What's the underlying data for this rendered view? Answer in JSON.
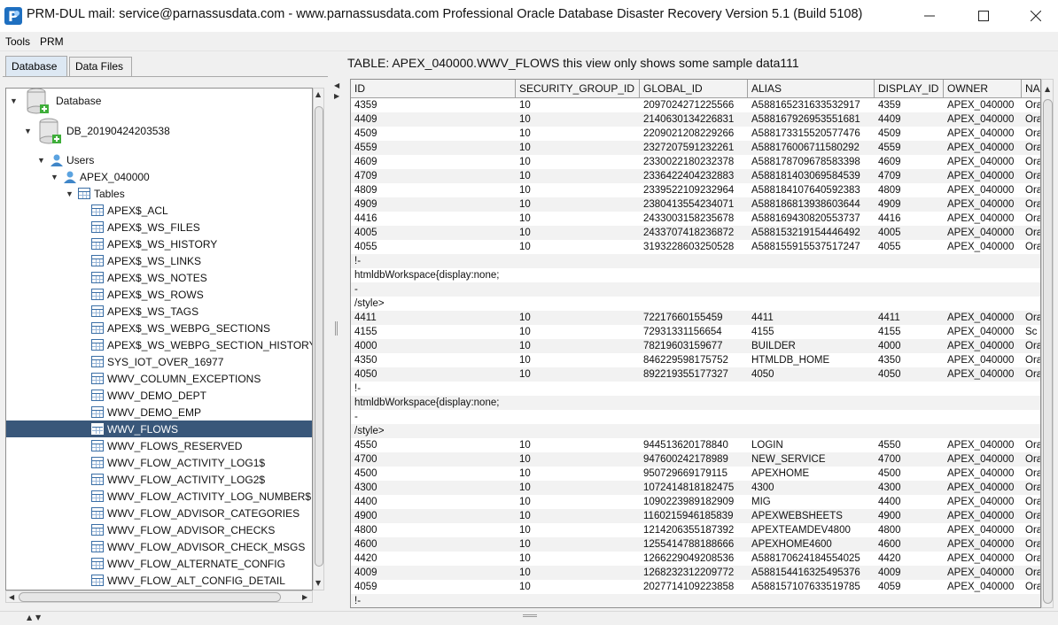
{
  "window": {
    "title": "PRM-DUL mail: service@parnassusdata.com - www.parnassusdata.com  Professional Oracle Database Disaster Recovery   Version 5.1 (Build 5108)",
    "app_icon": "prm-logo-icon",
    "controls": [
      "minimize-icon",
      "maximize-icon",
      "close-icon"
    ]
  },
  "menu": {
    "items": [
      "Tools",
      "PRM"
    ]
  },
  "left": {
    "tabs": [
      "Database",
      "Data Files"
    ],
    "active_tab": "Database",
    "tree": {
      "root": "Database",
      "db": "DB_20190424203538",
      "users": "Users",
      "user": "APEX_040000",
      "tables": "Tables",
      "table_items": [
        "APEX$_ACL",
        "APEX$_WS_FILES",
        "APEX$_WS_HISTORY",
        "APEX$_WS_LINKS",
        "APEX$_WS_NOTES",
        "APEX$_WS_ROWS",
        "APEX$_WS_TAGS",
        "APEX$_WS_WEBPG_SECTIONS",
        "APEX$_WS_WEBPG_SECTION_HISTORY",
        "SYS_IOT_OVER_16977",
        "WWV_COLUMN_EXCEPTIONS",
        "WWV_DEMO_DEPT",
        "WWV_DEMO_EMP",
        "WWV_FLOWS",
        "WWV_FLOWS_RESERVED",
        "WWV_FLOW_ACTIVITY_LOG1$",
        "WWV_FLOW_ACTIVITY_LOG2$",
        "WWV_FLOW_ACTIVITY_LOG_NUMBER$",
        "WWV_FLOW_ADVISOR_CATEGORIES",
        "WWV_FLOW_ADVISOR_CHECKS",
        "WWV_FLOW_ADVISOR_CHECK_MSGS",
        "WWV_FLOW_ALTERNATE_CONFIG",
        "WWV_FLOW_ALT_CONFIG_DETAIL"
      ],
      "selected": "WWV_FLOWS"
    }
  },
  "right": {
    "title": "TABLE: APEX_040000.WWV_FLOWS this view only shows some sample data111",
    "columns": [
      "ID",
      "SECURITY_GROUP_ID",
      "GLOBAL_ID",
      "ALIAS",
      "DISPLAY_ID",
      "OWNER",
      "NA"
    ],
    "rows": [
      [
        "4359",
        "10",
        "2097024271225566",
        "A588165231633532917",
        "4359",
        "APEX_040000",
        "Ora"
      ],
      [
        "4409",
        "10",
        "2140630134226831",
        "A588167926953551681",
        "4409",
        "APEX_040000",
        "Ora"
      ],
      [
        "4509",
        "10",
        "2209021208229266",
        "A588173315520577476",
        "4509",
        "APEX_040000",
        "Ora"
      ],
      [
        "4559",
        "10",
        "2327207591232261",
        "A588176006711580292",
        "4559",
        "APEX_040000",
        "Ora"
      ],
      [
        "4609",
        "10",
        "2330022180232378",
        "A588178709678583398",
        "4609",
        "APEX_040000",
        "Ora"
      ],
      [
        "4709",
        "10",
        "2336422404232883",
        "A588181403069584539",
        "4709",
        "APEX_040000",
        "Ora"
      ],
      [
        "4809",
        "10",
        "2339522109232964",
        "A588184107640592383",
        "4809",
        "APEX_040000",
        "Ora"
      ],
      [
        "4909",
        "10",
        "2380413554234071",
        "A588186813938603644",
        "4909",
        "APEX_040000",
        "Ora"
      ],
      [
        "4416",
        "10",
        "2433003158235678",
        "A588169430820553737",
        "4416",
        "APEX_040000",
        "Ora"
      ],
      [
        "4005",
        "10",
        "2433707418236872",
        "A588153219154446492",
        "4005",
        "APEX_040000",
        "Ora"
      ],
      [
        "4055",
        "10",
        "3193228603250528",
        "A588155915537517247",
        "4055",
        "APEX_040000",
        "Ora"
      ],
      [
        "!-",
        "",
        "",
        "",
        "",
        "",
        ""
      ],
      [
        "htmldbWorkspace{display:none;",
        "",
        "",
        "",
        "",
        "",
        ""
      ],
      [
        "-",
        "",
        "",
        "",
        "",
        "",
        ""
      ],
      [
        "/style>",
        "",
        "",
        "",
        "",
        "",
        ""
      ],
      [
        "4411",
        "10",
        "72217660155459",
        "4411",
        "4411",
        "APEX_040000",
        "Ora"
      ],
      [
        "4155",
        "10",
        "72931331156654",
        "4155",
        "4155",
        "APEX_040000",
        "Sc"
      ],
      [
        "4000",
        "10",
        "78219603159677",
        "BUILDER",
        "4000",
        "APEX_040000",
        "Ora"
      ],
      [
        "4350",
        "10",
        "846229598175752",
        "HTMLDB_HOME",
        "4350",
        "APEX_040000",
        "Ora"
      ],
      [
        "4050",
        "10",
        "892219355177327",
        "4050",
        "4050",
        "APEX_040000",
        "Ora"
      ],
      [
        "!-",
        "",
        "",
        "",
        "",
        "",
        ""
      ],
      [
        "htmldbWorkspace{display:none;",
        "",
        "",
        "",
        "",
        "",
        ""
      ],
      [
        "-",
        "",
        "",
        "",
        "",
        "",
        ""
      ],
      [
        "/style>",
        "",
        "",
        "",
        "",
        "",
        ""
      ],
      [
        "4550",
        "10",
        "944513620178840",
        "LOGIN",
        "4550",
        "APEX_040000",
        "Ora"
      ],
      [
        "4700",
        "10",
        "947600242178989",
        "NEW_SERVICE",
        "4700",
        "APEX_040000",
        "Ora"
      ],
      [
        "4500",
        "10",
        "950729669179115",
        "APEXHOME",
        "4500",
        "APEX_040000",
        "Ora"
      ],
      [
        "4300",
        "10",
        "1072414818182475",
        "4300",
        "4300",
        "APEX_040000",
        "Ora"
      ],
      [
        "4400",
        "10",
        "1090223989182909",
        "MIG",
        "4400",
        "APEX_040000",
        "Ora"
      ],
      [
        "4900",
        "10",
        "1160215946185839",
        "APEXWEBSHEETS",
        "4900",
        "APEX_040000",
        "Ora"
      ],
      [
        "4800",
        "10",
        "1214206355187392",
        "APEXTEAMDEV4800",
        "4800",
        "APEX_040000",
        "Ora"
      ],
      [
        "4600",
        "10",
        "1255414788188666",
        "APEXHOME4600",
        "4600",
        "APEX_040000",
        "Ora"
      ],
      [
        "4420",
        "10",
        "1266229049208536",
        "A588170624184554025",
        "4420",
        "APEX_040000",
        "Ora"
      ],
      [
        "4009",
        "10",
        "1268232312209772",
        "A588154416325495376",
        "4009",
        "APEX_040000",
        "Ora"
      ],
      [
        "4059",
        "10",
        "2027714109223858",
        "A588157107633519785",
        "4059",
        "APEX_040000",
        "Ora"
      ],
      [
        "!-",
        "",
        "",
        "",
        "",
        "",
        ""
      ]
    ]
  }
}
